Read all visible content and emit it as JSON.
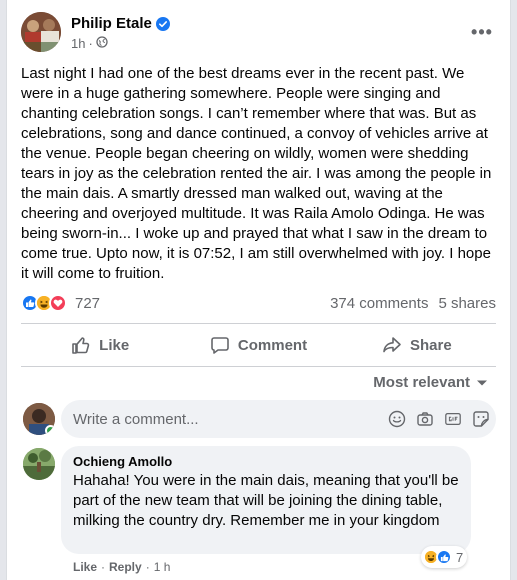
{
  "post": {
    "author": "Philip Etale",
    "time": "1h",
    "separator": "·",
    "more": "•••",
    "text": "Last night I had one of the best dreams ever in the recent past. We were in a huge gathering somewhere. People were singing and chanting celebration songs. I can’t remember where that was. But as celebrations, song and dance continued, a convoy of vehicles arrive at the venue. People began cheering on wildly, women were shedding tears in joy as the celebration rented the air. I was among the people in the main dais. A smartly dressed man walked out, waving at the cheering and overjoyed multitude. It was Raila Amolo Odinga. He was being sworn-in... I woke up and prayed that what I saw in the dream to come true. Upto now, it is 07:52, I am still overwhelmed with joy. I hope it will come to fruition."
  },
  "stats": {
    "reaction_count": "727",
    "comments": "374 comments",
    "shares": "5 shares",
    "reaction_icons": [
      "like-icon",
      "haha-icon",
      "love-icon"
    ]
  },
  "actions": {
    "like": "Like",
    "comment": "Comment",
    "share": "Share"
  },
  "sort": {
    "label": "Most relevant"
  },
  "composer": {
    "placeholder": "Write a comment...",
    "icons": [
      "emoji-icon",
      "camera-icon",
      "gif-icon",
      "sticker-icon"
    ]
  },
  "comment": {
    "author": "Ochieng Amollo",
    "text": "Hahaha! You were in the main dais, meaning that you'll be part of the new team that will be joining the dining table, milking the country dry. Remember me in your kingdom",
    "reaction_count": "7",
    "like": "Like",
    "reply": "Reply",
    "time": "1 h",
    "sep": "·"
  },
  "colors": {
    "like_blue": "#1877f2",
    "love_red": "#f33e58",
    "haha_yellow": "#f7b125",
    "secondary_text": "#65676b",
    "online_green": "#31a24c"
  }
}
